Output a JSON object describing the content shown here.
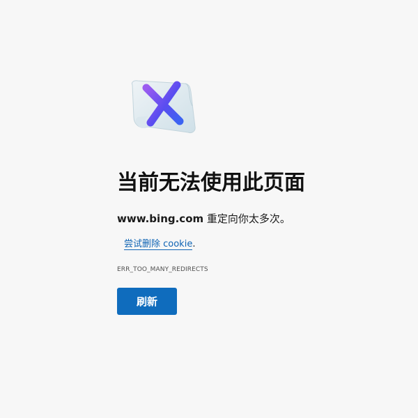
{
  "error_page": {
    "illustration_icon": "error-x-document-icon",
    "title": "当前无法使用此页面",
    "domain": "www.bing.com",
    "message_suffix": " 重定向你太多次。",
    "suggestion_link": "尝试删除 cookie",
    "suggestion_suffix": ".",
    "error_code": "ERR_TOO_MANY_REDIRECTS",
    "refresh_label": "刷新"
  },
  "colors": {
    "background": "#f7f7f7",
    "accent": "#0f6cbd",
    "link": "#0f64b4"
  }
}
